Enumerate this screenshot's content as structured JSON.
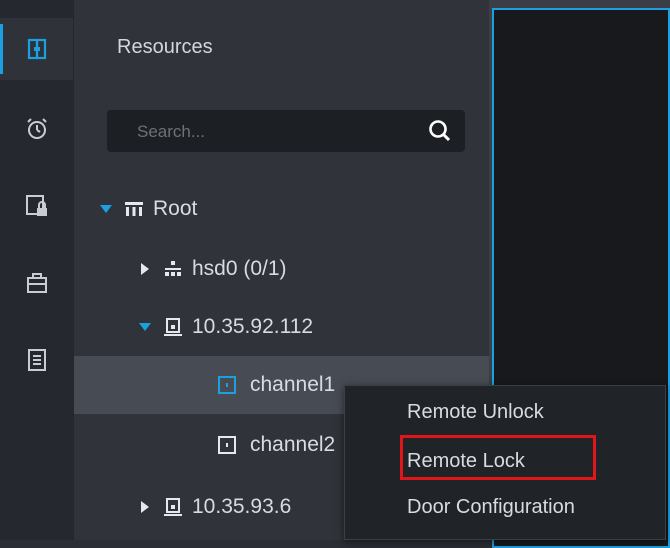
{
  "sidebar": {
    "items": [
      {
        "icon": "door-access-icon",
        "active": true
      },
      {
        "icon": "alarm-clock-icon",
        "active": false
      },
      {
        "icon": "locked-screen-icon",
        "active": false
      },
      {
        "icon": "toolbox-icon",
        "active": false
      },
      {
        "icon": "document-list-icon",
        "active": false
      }
    ]
  },
  "panel": {
    "title": "Resources",
    "search": {
      "placeholder": "Search..."
    }
  },
  "tree": {
    "root": {
      "label": "Root"
    },
    "nodes": [
      {
        "label": "hsd0 (0/1)",
        "icon": "network-icon",
        "expanded": false
      },
      {
        "label": "10.35.92.112",
        "icon": "device-icon",
        "expanded": true
      },
      {
        "label": "channel1",
        "icon": "channel-icon",
        "selected": true
      },
      {
        "label": "channel2",
        "icon": "channel-icon",
        "selected": false
      },
      {
        "label": "10.35.93.6",
        "icon": "device-icon",
        "expanded": false
      }
    ]
  },
  "context_menu": {
    "items": [
      "Remote Unlock",
      "Remote Lock",
      "Door Configuration"
    ],
    "highlighted": "Remote Lock"
  },
  "colors": {
    "accent": "#1ba1e2",
    "highlight": "#e0161b"
  }
}
